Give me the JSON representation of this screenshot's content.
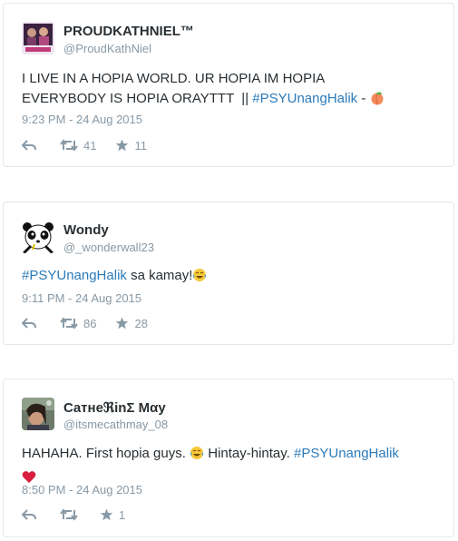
{
  "tweets": [
    {
      "name": "PROUDKATHNIEL™",
      "handle": "@ProudKathNiel",
      "text_line1": "I LIVE IN A HOPIA WORLD. UR HOPIA IM HOPIA",
      "text_line2": "EVERYBODY IS HOPIA ORAYTTT  || ",
      "hashtag": "#PSYUnangHalik",
      "text_after": " -",
      "time": "9:23 PM - 24 Aug 2015",
      "retweets": "41",
      "favorites": "11",
      "emoji_icon": "peach-emoji-icon"
    },
    {
      "name": "Wondy",
      "handle": "@_wonderwall23",
      "hashtag": "#PSYUnangHalik",
      "text_after": " sa kamay!",
      "time": "9:11 PM - 24 Aug 2015",
      "retweets": "86",
      "favorites": "28",
      "emoji_icon": "tears-of-joy-emoji-icon"
    },
    {
      "name": "CатнeℜіnΣ Mαy",
      "handle": "@itsmecathmay_08",
      "text_before": "HAHAHA. First hopia guys. ",
      "text_middle": " Hintay-hintay. ",
      "hashtag": "#PSYUnangHalik",
      "time": "8:50 PM - 24 Aug 2015",
      "retweets": "",
      "favorites": "1",
      "emoji_icon": "heart-emoji-icon"
    }
  ],
  "colors": {
    "hashtag": "#2b7bb9",
    "meta": "#8899a6",
    "border": "#e1e8ed"
  }
}
